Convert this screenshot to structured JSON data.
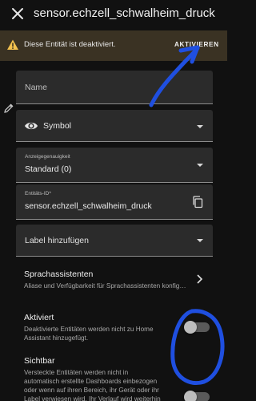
{
  "header": {
    "title": "sensor.echzell_schwalheim_druck",
    "close_icon": "close-icon"
  },
  "banner": {
    "message": "Diese Entität ist deaktiviert.",
    "action_label": "AKTIVIEREN",
    "icon": "warning-icon",
    "background": "#3a3223",
    "icon_color": "#f2c14e"
  },
  "form": {
    "name_placeholder": "Name",
    "icon_field_label": "Symbol",
    "precision_label": "Anzeigegenauigkeit",
    "precision_value": "Standard (0)",
    "entity_id_label": "Entitäts-ID*",
    "entity_id_value": "sensor.echzell_schwalheim_druck",
    "labels_placeholder": "Label hinzufügen"
  },
  "voice_assistants": {
    "title": "Sprachassistenten",
    "subtitle": "Aliase und Verfügbarkeit für Sprachassistenten konfig…"
  },
  "enabled_setting": {
    "title": "Aktiviert",
    "description_line1": "Deaktivierte Entitäten werden nicht zu Home",
    "description_line2": "Assistant hinzugefügt.",
    "on": false
  },
  "visible_setting": {
    "title": "Sichtbar",
    "description_line1": "Versteckte Entitäten werden nicht in",
    "description_line2": "automatisch erstellte Dashboards einbezogen",
    "description_line3": "oder wenn auf ihren Bereich, ihr Gerät oder ihr",
    "description_line4": "Label verwiesen wird. Ihr Verlauf wird weiterhin",
    "on": false
  },
  "annotation_color": "#1f4fe0"
}
